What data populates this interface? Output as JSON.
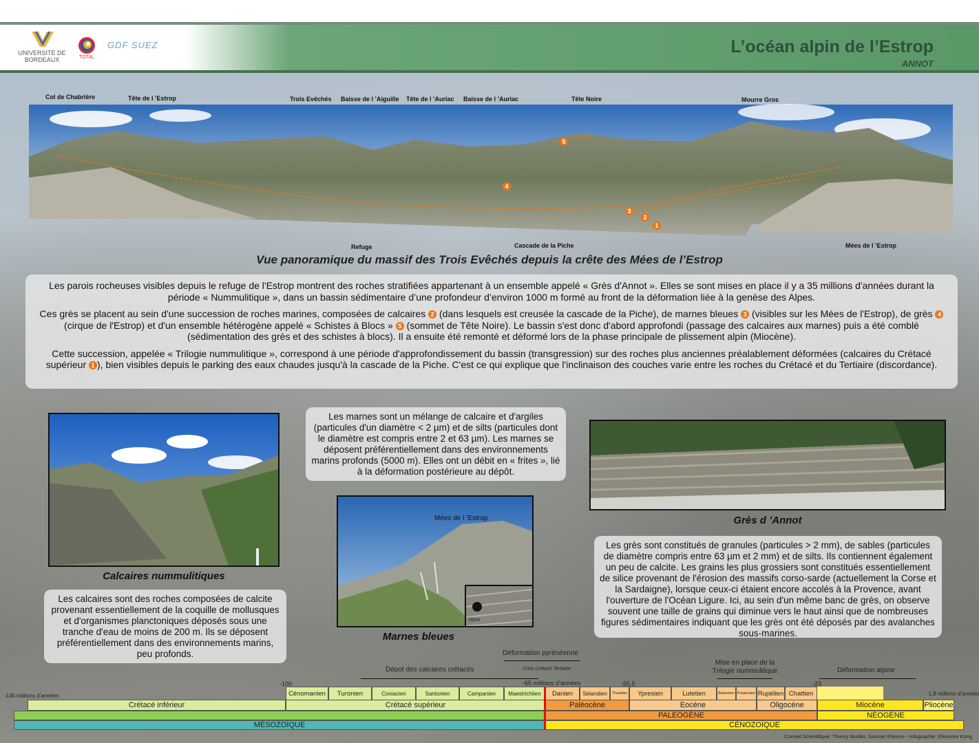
{
  "header": {
    "title": "L’océan alpin de l’Estrop",
    "subtitle": "ANNOT",
    "logos": [
      "UNIVERSITÉ DE BORDEAUX",
      "TOTAL",
      "GDF SUEZ"
    ]
  },
  "panorama": {
    "caption": "Vue panoramique du massif des Trois Evêchés depuis la crête des Mées de l’Estrop",
    "top_labels": [
      "Col de Chabrière",
      "Tête de l ’Estrop",
      "Trois Evêchés",
      "Baisse de l ’Aiguille",
      "Tête de l ’Auriac",
      "Baisse de l ’Auriac",
      "Tête Noire",
      "Mourre Gros"
    ],
    "bottom_labels": [
      "Refuge",
      "Cascade de la Piche",
      "Mées de l ’Estrop"
    ],
    "markers": [
      "5",
      "4",
      "3",
      "2",
      "1"
    ]
  },
  "intro": {
    "p1": "Les parois rocheuses visibles depuis le refuge de l'Estrop montrent des roches stratifiées appartenant à un ensemble appelé « Grès d'Annot ». Elles se sont mises en place il y a 35 millions d'années durant la période « Nummulitique », dans un bassin sédimentaire d’une profondeur d’environ 1000 m formé au front de la déformation liée à la genèse des Alpes.",
    "p2a": "Ces grès se placent au sein d'une succession de roches marines, composées de calcaires",
    "p2b": "(dans lesquels est creusée la cascade de la Piche), de marnes bleues",
    "p2c": "(visibles sur les Mées de l'Estrop), de grès",
    "p2d": "(cirque de l'Estrop) et d'un ensemble hétérogène appelé « Schistes à Blocs »",
    "p2e": "(sommet de Tête Noire). Le bassin s'est donc d'abord approfondi (passage des calcaires aux marnes) puis a été comblé (sédimentation des grès et des schistes à blocs). Il a ensuite été remonté et déformé lors de la phase principale de plissement alpin (Miocène).",
    "p3a": "Cette succession, appelée « Trilogie nummulitique », correspond à une période d'approfondissement du bassin (transgression) sur des roches plus anciennes préalablement déformées (calcaires du Crétacé supérieur",
    "p3b": "), bien visibles depuis le parking des eaux chaudes jusqu'à la cascade de la Piche. C'est ce qui explique que l'inclinaison des couches varie entre les roches du Crétacé et du Tertiaire (discordance).",
    "n1": "1",
    "n2": "2",
    "n3": "3",
    "n4": "4",
    "n5": "5"
  },
  "sections": {
    "calcaires": {
      "caption": "Calcaires nummulitiques",
      "text": "Les calcaires sont des roches composées de calcite provenant essentiellement de la coquille de mollusques et d'organismes planctoniques déposés sous une tranche d'eau de moins de 200 m. Ils se déposent préférentiellement dans des environnements marins, peu profonds."
    },
    "marnes": {
      "text": "Les marnes sont un mélange de calcaire et d'argiles (particules d'un diamètre < 2 µm) et de silts (particules dont le diamètre est compris entre 2 et 63 µm). Les marnes se déposent préférentiellement dans des environnements marins profonds (5000 m). Elles ont un débit en « frites », lié à la déformation postérieure au dépôt.",
      "caption": "Marnes bleues",
      "photo_label": "Mées de l ’Estrop",
      "scale": "10cm"
    },
    "gres": {
      "caption": "Grès d ’Annot",
      "text": "Les grès sont constitués de granules (particules > 2 mm), de sables (particules de diamètre compris entre 63 µm et 2 mm) et de silts. Ils contiennent également un peu de calcite. Les grains les plus grossiers sont constitués essentiellement de silice provenant de l'érosion des massifs corso-sarde (actuellement la Corse et la Sardaigne), lorsque ceux-ci étaient encore accolés à la Provence, avant l'ouverture de l'Océan Ligure. Ici, au sein d'un même banc de grès, on observe souvent une taille de grains qui diminue vers le haut ainsi que de nombreuses figures sédimentaires indiquant que les grès ont été déposés par des avalanches sous-marines."
    }
  },
  "timeline": {
    "events": {
      "deformation_pyreneenne": "Déformation pyrénéenne",
      "depot_calcaires": "Dépot des calcaires crétacés",
      "crise": "Crise Crétacé Tertiaire",
      "age_65": "-65 millions d’années",
      "trilogie": "Mise en place de la Trilogie nummulitique",
      "deformation_alpine": "Déformation alpine"
    },
    "ticks": {
      "start": "-145 millions d’années",
      "m100": "-100",
      "m55": "-55,5",
      "m23": "-23",
      "end": "-1,8 millions d’années"
    },
    "stages": [
      "Cénomanien",
      "Turonien",
      "Coniacien",
      "Santonien",
      "Campanien",
      "Maestrichtien",
      "Danien",
      "Sélandien",
      "Thanétien",
      "Ypresien",
      "Lutetien",
      "Bartonien",
      "Priabonien",
      "Rupélien",
      "Chattien"
    ],
    "epochs": [
      "Crétacé inférieur",
      "Crétacé supérieur",
      "Paléocène",
      "Eocène",
      "Oligocène",
      "Miocène",
      "Pliocène"
    ],
    "periods": [
      "PALÉOGÈNE",
      "NÉOGÈNE"
    ],
    "eras": [
      "MÉSOZOÏQUE",
      "CÉNOZOÏQUE"
    ],
    "colors": {
      "cretace_light": "#d8ee9c",
      "cretace": "#8ccf52",
      "mesozoic": "#4fb8b4",
      "paleogene_light": "#f8c98a",
      "paleogene": "#f39a3c",
      "neogene_light": "#fff27a",
      "neogene": "#ffe620",
      "boundary": "#dd1111"
    }
  },
  "credits": "Conseil Scientifique: Thierry Mulder, Samuel Etienne - Infographie: Eléonore Köng"
}
